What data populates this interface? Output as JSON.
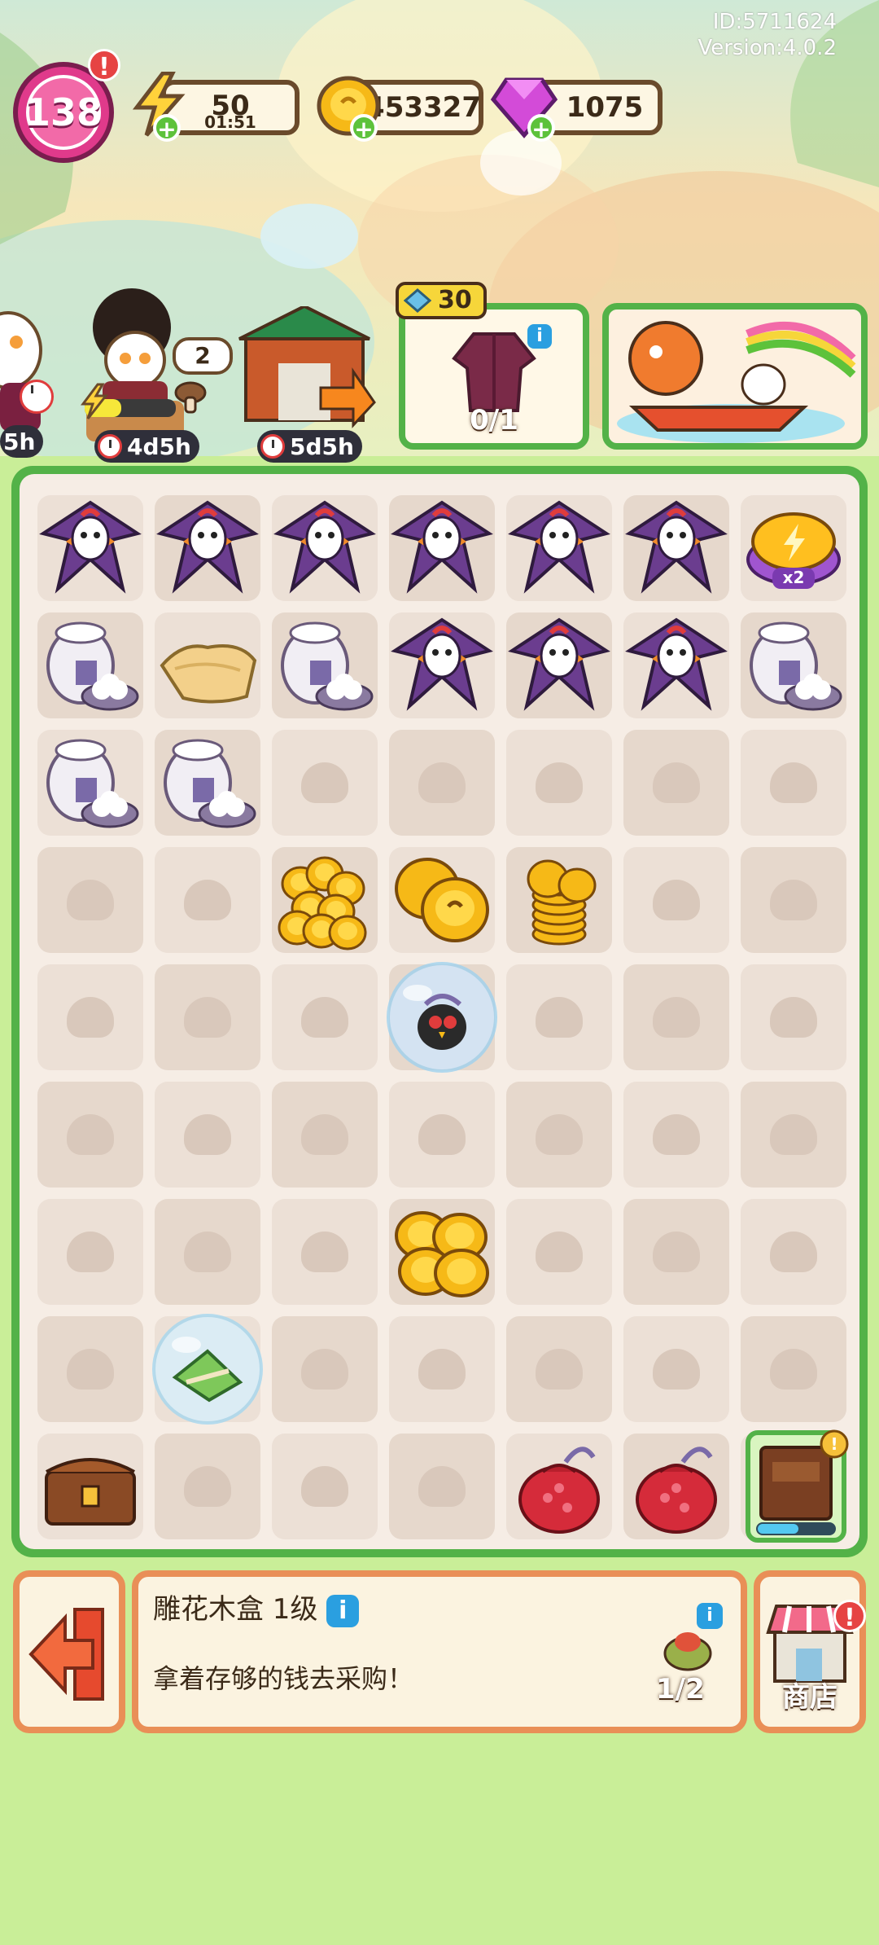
{
  "hud": {
    "player_level": "138",
    "energy": "50",
    "energy_timer": "01:51",
    "coins": "453327",
    "gems": "1075",
    "id_text": "ID:5711624",
    "version_text": "Version:4.0.2"
  },
  "characters": [
    {
      "timer": "5h"
    },
    {
      "timer": "4d5h",
      "bubble_count": "2"
    },
    {
      "timer": "5d5h"
    }
  ],
  "event_card": {
    "kite_count": "30",
    "progress": "0/1"
  },
  "board": {
    "rows": 9,
    "cols": 7,
    "items": [
      {
        "row": 0,
        "col": 0,
        "type": "kite"
      },
      {
        "row": 0,
        "col": 1,
        "type": "kite"
      },
      {
        "row": 0,
        "col": 2,
        "type": "kite"
      },
      {
        "row": 0,
        "col": 3,
        "type": "kite"
      },
      {
        "row": 0,
        "col": 4,
        "type": "kite"
      },
      {
        "row": 0,
        "col": 5,
        "type": "kite"
      },
      {
        "row": 0,
        "col": 6,
        "type": "energy-button",
        "label": "x2"
      },
      {
        "row": 1,
        "col": 0,
        "type": "rice-jar"
      },
      {
        "row": 1,
        "col": 1,
        "type": "cloth"
      },
      {
        "row": 1,
        "col": 2,
        "type": "rice-jar"
      },
      {
        "row": 1,
        "col": 3,
        "type": "kite"
      },
      {
        "row": 1,
        "col": 4,
        "type": "kite"
      },
      {
        "row": 1,
        "col": 5,
        "type": "kite"
      },
      {
        "row": 1,
        "col": 6,
        "type": "rice-jar"
      },
      {
        "row": 2,
        "col": 0,
        "type": "rice-jar"
      },
      {
        "row": 2,
        "col": 1,
        "type": "rice-jar"
      },
      {
        "row": 3,
        "col": 2,
        "type": "coins-pile"
      },
      {
        "row": 3,
        "col": 3,
        "type": "coins-two"
      },
      {
        "row": 3,
        "col": 4,
        "type": "coins-stack"
      },
      {
        "row": 4,
        "col": 3,
        "type": "bubble-bird"
      },
      {
        "row": 6,
        "col": 3,
        "type": "coins-four"
      },
      {
        "row": 7,
        "col": 1,
        "type": "bubble-zongzi"
      },
      {
        "row": 8,
        "col": 0,
        "type": "wood-chest"
      },
      {
        "row": 8,
        "col": 4,
        "type": "red-pouch"
      },
      {
        "row": 8,
        "col": 5,
        "type": "red-pouch"
      },
      {
        "row": 8,
        "col": 6,
        "type": "carved-box"
      }
    ]
  },
  "info_panel": {
    "title": "雕花木盒 1级",
    "description": "拿着存够的钱去采购！",
    "progress": "1/2"
  },
  "shop": {
    "label": "商店"
  },
  "colors": {
    "board_border": "#53b248",
    "panel_border": "#e98f57",
    "background": "#c9ee98"
  }
}
